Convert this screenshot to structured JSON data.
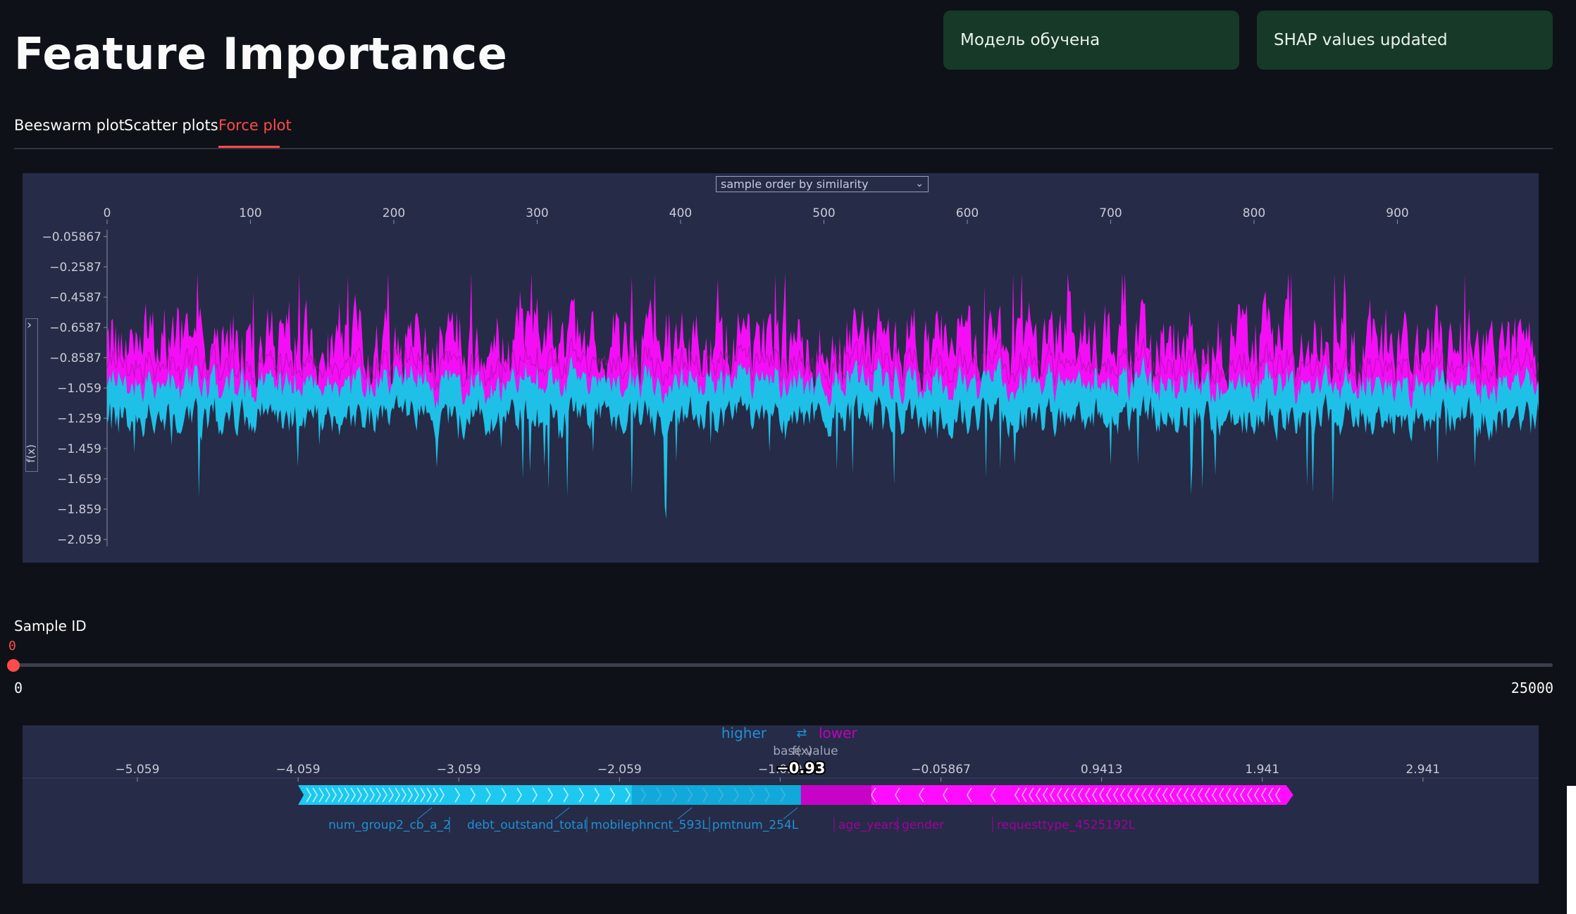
{
  "page": {
    "title": "Feature Importance",
    "notifications": [
      "Модель обучена",
      "SHAP values updated"
    ]
  },
  "tabs": [
    {
      "label": "Beeswarm plot",
      "active": false
    },
    {
      "label": "Scatter plots",
      "active": false
    },
    {
      "label": "Force plot",
      "active": true
    }
  ],
  "force_array": {
    "ordering_select": "sample order by similarity",
    "y_axis_label": "f(x)",
    "expand_icon": "chevron-right-icon"
  },
  "slider": {
    "label": "Sample ID",
    "value": "0",
    "min": "0",
    "max": "25000",
    "fraction": 0
  },
  "force_single": {
    "higher_label": "higher",
    "lower_label": "lower",
    "arrow_icon": "swap-arrows-icon",
    "base_value_label": "base value",
    "fx_label": "f(x)",
    "fx_value": "−0.93",
    "blue_features": [
      "num_group2_cb_a_2",
      "debt_outstand_total",
      "mobilephncnt_593L",
      "pmtnum_254L"
    ],
    "magenta_features": [
      "age_years",
      "gender",
      "requesttype_4525192L"
    ]
  },
  "colors": {
    "accent": "#ff4b4b",
    "positive": "#ff0dff",
    "negative": "#1ec8f0",
    "panel": "#262b47",
    "toast": "#173928"
  },
  "chart_data": [
    {
      "type": "area",
      "x_ticks": [
        "0",
        "100",
        "200",
        "300",
        "400",
        "500",
        "600",
        "700",
        "800",
        "900"
      ],
      "x_range": [
        0,
        1000
      ],
      "y_ticks": [
        "−0.05867",
        "−0.2587",
        "−0.4587",
        "−0.6587",
        "−0.8587",
        "−1.059",
        "−1.259",
        "−1.459",
        "−1.659",
        "−1.859",
        "−2.059"
      ],
      "y_range": [
        -2.059,
        -0.05867
      ],
      "ylabel": "f(x)",
      "series": [
        {
          "name": "higher",
          "color": "#ff0dff",
          "band": "upper",
          "mean_upper": -0.75,
          "mean_lower": -1.05
        },
        {
          "name": "lower",
          "color": "#1ec8f0",
          "band": "lower",
          "mean_upper": -1.05,
          "mean_lower": -1.25
        }
      ],
      "legend": "none"
    },
    {
      "type": "bar",
      "x_ticks": [
        "−5.059",
        "−4.059",
        "−3.059",
        "−2.059",
        "−1.059",
        "−0.05867",
        "0.9413",
        "1.941",
        "2.941"
      ],
      "x_range": [
        -5.77,
        3.7
      ],
      "base_value": -1.059,
      "output_value": -0.93,
      "segments": [
        {
          "direction": "higher",
          "from": -4.059,
          "to": -0.93,
          "color": "#1ec8f0"
        },
        {
          "direction": "lower",
          "from": -0.93,
          "to": 2.09,
          "color": "#ff0dff"
        }
      ]
    }
  ]
}
